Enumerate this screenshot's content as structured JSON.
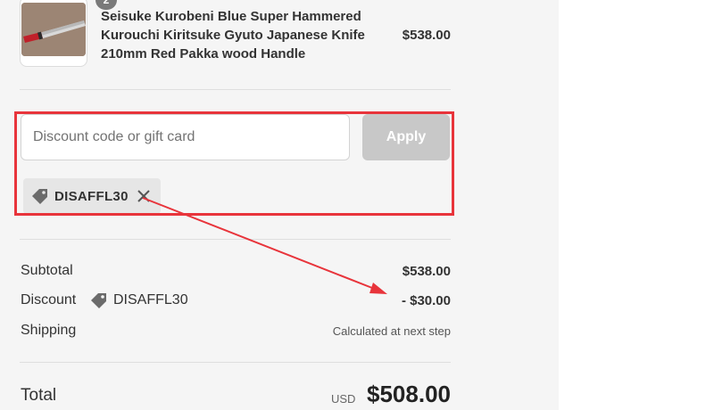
{
  "product": {
    "quantity": "2",
    "name": "Seisuke Kurobeni Blue Super Hammered Kurouchi Kiritsuke Gyuto Japanese Knife 210mm Red Pakka wood Handle",
    "price": "$538.00"
  },
  "discount_form": {
    "placeholder": "Discount code or gift card",
    "value": "",
    "apply_label": "Apply"
  },
  "applied_code": {
    "code": "DISAFFL30",
    "icon": "tag-icon",
    "remove_icon": "close-icon"
  },
  "totals": {
    "subtotal_label": "Subtotal",
    "subtotal_value": "$538.00",
    "discount_label": "Discount",
    "discount_code": "DISAFFL30",
    "discount_value": "- $30.00",
    "shipping_label": "Shipping",
    "shipping_value": "Calculated at next step",
    "total_label": "Total",
    "currency": "USD",
    "total_value": "$508.00"
  },
  "annotation": {
    "highlight_color": "#e8343b"
  },
  "colors": {
    "summary_bg": "#f5f5f5",
    "apply_button_disabled": "#c8c8c8",
    "tag_bg": "#e6e6e6"
  }
}
